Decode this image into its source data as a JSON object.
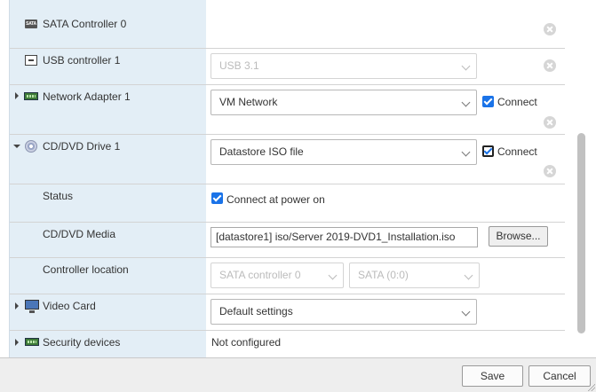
{
  "hardware": {
    "sata_controller": {
      "label": "SATA Controller 0",
      "icon": "sata-icon"
    },
    "usb_controller": {
      "label": "USB controller 1",
      "icon": "usb-icon",
      "value": "USB 3.1"
    },
    "network_adapter": {
      "label": "Network Adapter 1",
      "icon": "network-adapter-icon",
      "value": "VM Network",
      "connect_label": "Connect",
      "connected": true
    },
    "cd_dvd_drive": {
      "label": "CD/DVD Drive 1",
      "icon": "cd-dvd-icon",
      "value": "Datastore ISO file",
      "connect_label": "Connect",
      "connected": true,
      "status": {
        "label": "Status",
        "option_label": "Connect at power on",
        "checked": true
      },
      "media": {
        "label": "CD/DVD Media",
        "value": "[datastore1] iso/Server 2019-DVD1_Installation.iso",
        "browse_label": "Browse..."
      },
      "controller_location": {
        "label": "Controller location",
        "controller": "SATA controller 0",
        "port": "SATA (0:0)"
      }
    },
    "video_card": {
      "label": "Video Card",
      "icon": "monitor-icon",
      "value": "Default settings"
    },
    "security_devices": {
      "label": "Security devices",
      "icon": "security-chip-icon",
      "value": "Not configured"
    }
  },
  "footer": {
    "save_label": "Save",
    "cancel_label": "Cancel"
  },
  "colors": {
    "label_column": "#e3eef6",
    "checkbox": "#1a73e8",
    "footer": "#eeeeee"
  }
}
